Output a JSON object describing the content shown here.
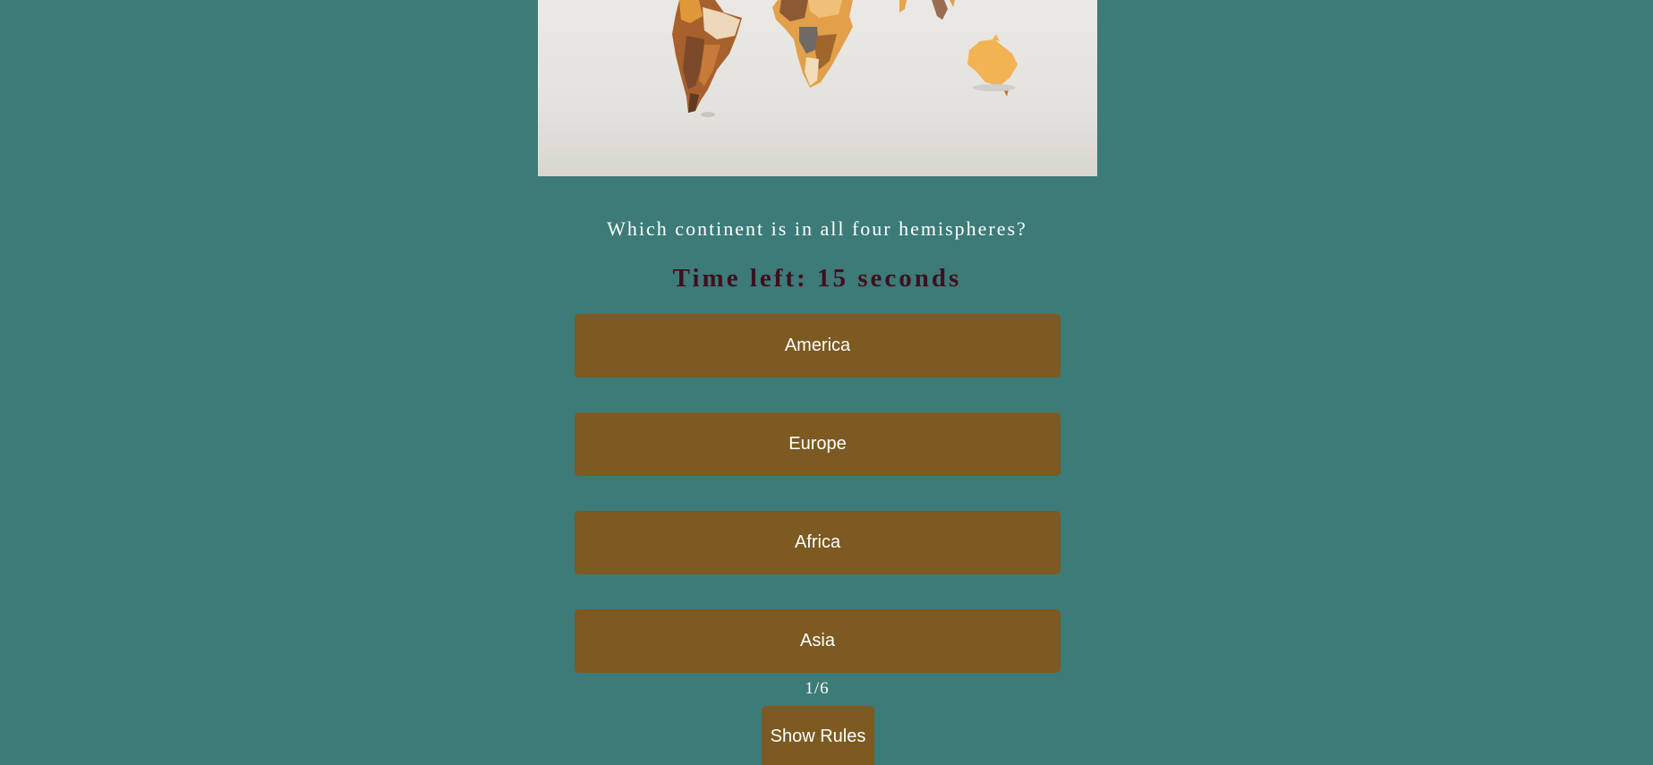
{
  "quiz": {
    "question": "Which continent is in all four hemispheres?",
    "timer": "Time left: 15 seconds",
    "answers": [
      "America",
      "Europe",
      "Africa",
      "Asia"
    ],
    "progress": "1/6",
    "rules_label": "Show Rules"
  },
  "colors": {
    "background": "#3c7b77",
    "button": "#7c5a21",
    "timer_text": "#3f0f1f",
    "text": "#ffffff"
  }
}
